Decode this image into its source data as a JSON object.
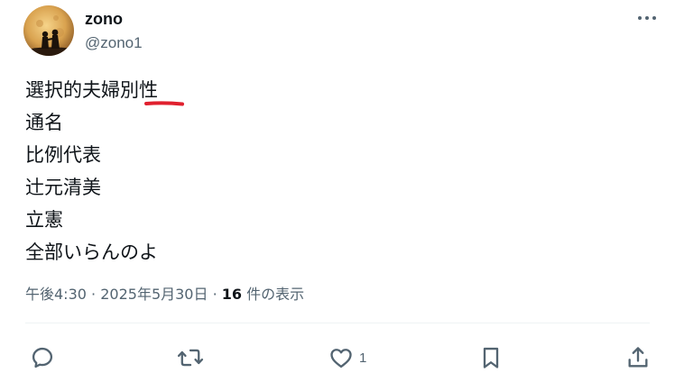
{
  "user": {
    "display_name": "zono",
    "handle": "@zono1"
  },
  "tweet": {
    "lines": [
      "選択的夫婦別性",
      "通名",
      "比例代表",
      "辻元清美",
      "立憲",
      "全部いらんのよ"
    ],
    "time": "午後4:30",
    "separator": "·",
    "date": "2025年5月30日",
    "views_count": "16",
    "views_label": "件の表示"
  },
  "actions": {
    "reply_count": "",
    "retweet_count": "",
    "like_count": "1",
    "bookmark_count": ""
  },
  "icons": {
    "more": "more-horizontal-icon",
    "reply": "reply-icon",
    "retweet": "retweet-icon",
    "like": "heart-icon",
    "bookmark": "bookmark-icon",
    "share": "share-icon"
  },
  "colors": {
    "text": "#0f1419",
    "secondary": "#536471",
    "annotation_underline": "#e0202e",
    "divider": "#eff3f4"
  }
}
